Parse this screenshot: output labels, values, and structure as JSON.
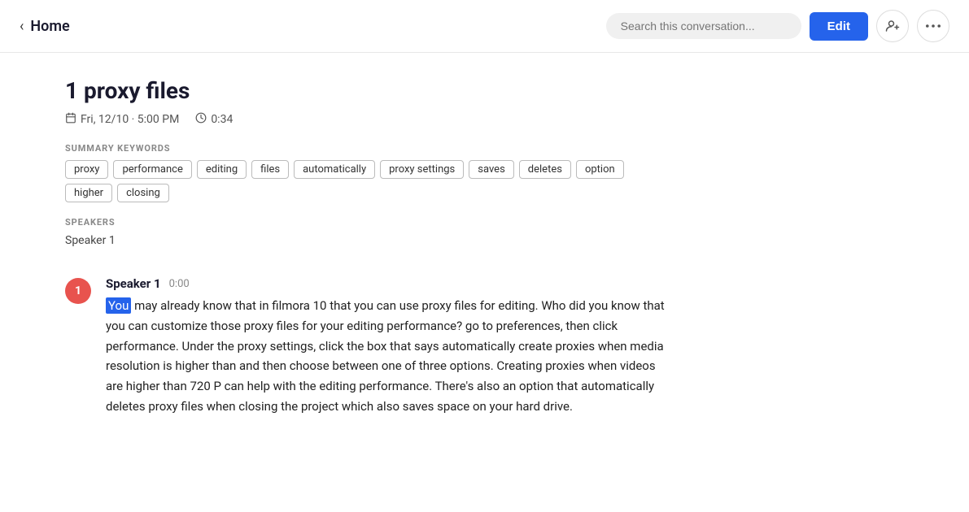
{
  "header": {
    "back_label": "‹",
    "home_label": "Home",
    "search_placeholder": "Search this conversation...",
    "edit_label": "Edit",
    "add_person_icon": "👤+",
    "more_icon": "•••"
  },
  "note": {
    "title": "1 proxy files",
    "date": "Fri, 12/10 · 5:00 PM",
    "duration": "0:34"
  },
  "summary": {
    "label": "SUMMARY KEYWORDS",
    "keywords": [
      "proxy",
      "performance",
      "editing",
      "files",
      "automatically",
      "proxy settings",
      "saves",
      "deletes",
      "option",
      "higher",
      "closing"
    ]
  },
  "speakers_section": {
    "label": "SPEAKERS",
    "speakers": [
      "Speaker 1"
    ]
  },
  "transcript": [
    {
      "badge": "1",
      "speaker": "Speaker 1",
      "timestamp": "0:00",
      "highlighted_word": "You",
      "text": " may already know that in filmora 10 that you can use proxy files for editing. Who did you know that you can customize those proxy files for your editing performance? go to preferences, then click performance. Under the proxy settings, click the box that says automatically create proxies when media resolution is higher than and then choose between one of three options. Creating proxies when videos are higher than 720 P can help with the editing performance. There's also an option that automatically deletes proxy files when closing the project which also saves space on your hard drive."
    }
  ]
}
